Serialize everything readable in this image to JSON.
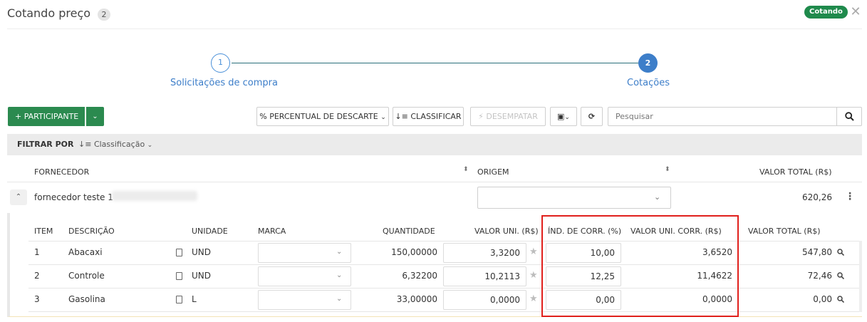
{
  "header": {
    "title": "Cotando preço",
    "count": "2",
    "status": "Cotando",
    "status_color": "#1f8a4c",
    "close_icon": "close-icon"
  },
  "stepper": {
    "step1_number": "1",
    "step1_label": "Solicitações de compra",
    "step2_number": "2",
    "step2_label": "Cotações",
    "active_step": 2
  },
  "toolbar": {
    "participante_label": "+ PARTICIPANTE",
    "percentual_label": "% PERCENTUAL DE DESCARTE",
    "classificar_label": "CLASSIFICAR",
    "desempatar_label": "DESEMPATAR",
    "search_placeholder": "Pesquisar"
  },
  "filter": {
    "label": "FILTRAR POR",
    "classificacao_label": "Classificação"
  },
  "supplier_table": {
    "headers": {
      "fornecedor": "FORNECEDOR",
      "origem": "ORIGEM",
      "valor_total": "VALOR TOTAL (R$)"
    },
    "rows": [
      {
        "name": "fornecedor teste 1",
        "origem": "",
        "total": "620,26"
      }
    ]
  },
  "items_table": {
    "headers": {
      "item": "ITEM",
      "descricao": "DESCRIÇÃO",
      "unidade": "UNIDADE",
      "marca": "MARCA",
      "quantidade": "QUANTIDADE",
      "valor_uni": "VALOR UNI. (R$)",
      "ind_corr": "ÍND. DE CORR. (%)",
      "valor_uni_corr": "VALOR UNI. CORR. (R$)",
      "valor_total": "VALOR TOTAL (R$)"
    },
    "rows": [
      {
        "item": "1",
        "descricao": "Abacaxi",
        "unidade": "UND",
        "marca": "",
        "quantidade": "150,00000",
        "valor_uni": "3,3200",
        "ind_corr": "10,00",
        "valor_uni_corr": "3,6520",
        "valor_total": "547,80"
      },
      {
        "item": "2",
        "descricao": "Controle",
        "unidade": "UND",
        "marca": "",
        "quantidade": "6,32200",
        "valor_uni": "10,2113",
        "ind_corr": "12,25",
        "valor_uni_corr": "11,4622",
        "valor_total": "72,46"
      },
      {
        "item": "3",
        "descricao": "Gasolina",
        "unidade": "L",
        "marca": "",
        "quantidade": "33,00000",
        "valor_uni": "0,0000",
        "ind_corr": "0,00",
        "valor_uni_corr": "0,0000",
        "valor_total": "0,00"
      }
    ]
  },
  "colors": {
    "primary_green": "#2b8a4f",
    "accent_blue": "#3d7ec9",
    "highlight_red": "#e0201c"
  }
}
